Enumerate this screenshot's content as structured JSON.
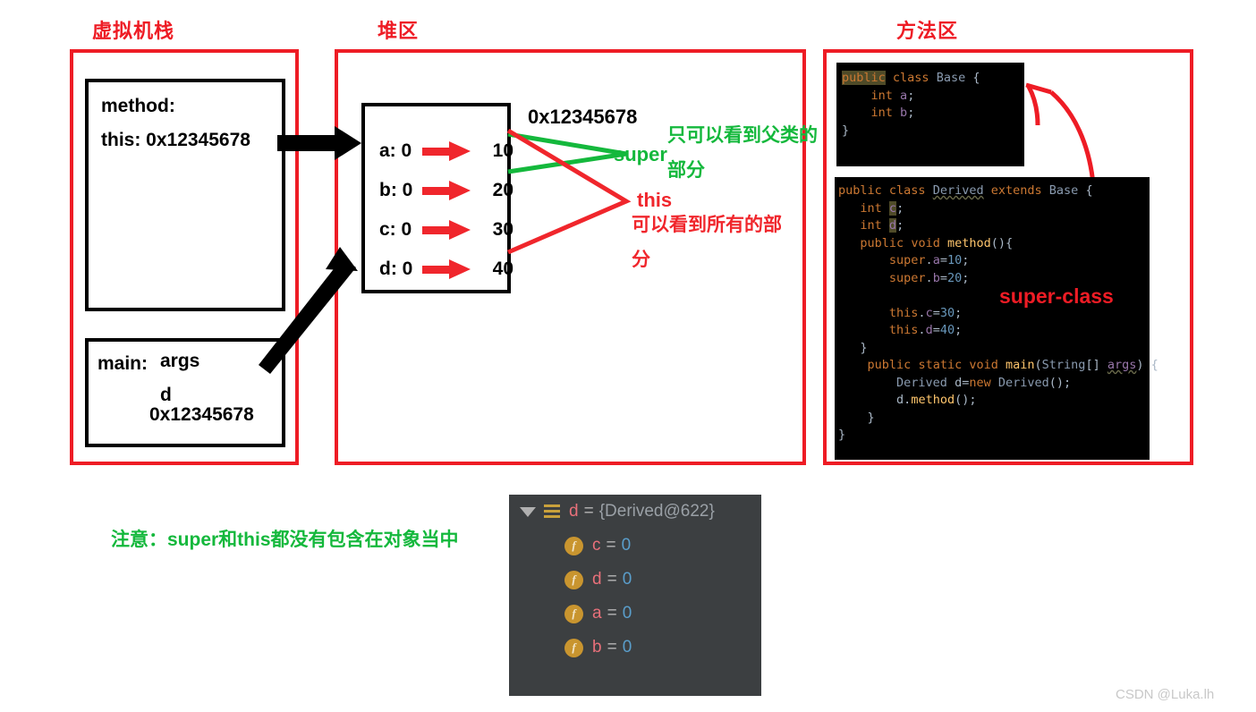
{
  "regions": {
    "stack": {
      "title": "虚拟机栈"
    },
    "heap": {
      "title": "堆区"
    },
    "method_area": {
      "title": "方法区"
    }
  },
  "stack_frames": {
    "method_frame": {
      "line1": "method:",
      "line2": "this: 0x12345678"
    },
    "main_frame": {
      "label": "main:",
      "args": "args",
      "var_name": "d",
      "var_value": "0x12345678"
    }
  },
  "heap": {
    "address": "0x12345678",
    "fields": [
      {
        "name": "a: 0",
        "value": "10"
      },
      {
        "name": "b: 0",
        "value": "20"
      },
      {
        "name": "c: 0",
        "value": "30"
      },
      {
        "name": "d: 0",
        "value": "40"
      }
    ]
  },
  "annotations": {
    "super_label": "super",
    "super_desc_line1": "只可以看到父类的",
    "super_desc_line2": "部分",
    "this_label": "this",
    "this_desc_line1": "可以看到所有的部",
    "this_desc_line2": "分",
    "super_class_label": "super-class",
    "note": "注意：super和this都没有包含在对象当中"
  },
  "code_base": {
    "lines": [
      [
        {
          "t": "public",
          "c": "kw hl"
        },
        {
          "t": " ",
          "c": "pnc"
        },
        {
          "t": "class",
          "c": "kw"
        },
        {
          "t": " ",
          "c": "pnc"
        },
        {
          "t": "Base",
          "c": "typ"
        },
        {
          "t": " {",
          "c": "pnc"
        }
      ],
      [
        {
          "t": "    ",
          "c": "pnc"
        },
        {
          "t": "int",
          "c": "kw"
        },
        {
          "t": " ",
          "c": "pnc"
        },
        {
          "t": "a",
          "c": "fld"
        },
        {
          "t": ";",
          "c": "pnc"
        }
      ],
      [
        {
          "t": "    ",
          "c": "pnc"
        },
        {
          "t": "int",
          "c": "kw"
        },
        {
          "t": " ",
          "c": "pnc"
        },
        {
          "t": "b",
          "c": "fld"
        },
        {
          "t": ";",
          "c": "pnc"
        }
      ],
      [
        {
          "t": "}",
          "c": "pnc"
        }
      ]
    ]
  },
  "code_derived": {
    "lines": [
      [
        {
          "t": "public",
          "c": "kw"
        },
        {
          "t": " ",
          "c": "pnc"
        },
        {
          "t": "class",
          "c": "kw"
        },
        {
          "t": " ",
          "c": "pnc"
        },
        {
          "t": "Derived",
          "c": "typ und"
        },
        {
          "t": " ",
          "c": "pnc"
        },
        {
          "t": "extends",
          "c": "kw"
        },
        {
          "t": " ",
          "c": "pnc"
        },
        {
          "t": "Base",
          "c": "typ"
        },
        {
          "t": " {",
          "c": "pnc"
        }
      ],
      [
        {
          "t": "   ",
          "c": "pnc"
        },
        {
          "t": "int",
          "c": "kw"
        },
        {
          "t": " ",
          "c": "pnc"
        },
        {
          "t": "c",
          "c": "fld hl"
        },
        {
          "t": ";",
          "c": "pnc"
        }
      ],
      [
        {
          "t": "   ",
          "c": "pnc"
        },
        {
          "t": "int",
          "c": "kw"
        },
        {
          "t": " ",
          "c": "pnc"
        },
        {
          "t": "d",
          "c": "fld hl"
        },
        {
          "t": ";",
          "c": "pnc"
        }
      ],
      [
        {
          "t": "   ",
          "c": "pnc"
        },
        {
          "t": "public",
          "c": "kw"
        },
        {
          "t": " ",
          "c": "pnc"
        },
        {
          "t": "void",
          "c": "kw"
        },
        {
          "t": " ",
          "c": "pnc"
        },
        {
          "t": "method",
          "c": "mth"
        },
        {
          "t": "(){",
          "c": "pnc"
        }
      ],
      [
        {
          "t": "       ",
          "c": "pnc"
        },
        {
          "t": "super",
          "c": "kw"
        },
        {
          "t": ".",
          "c": "pnc"
        },
        {
          "t": "a",
          "c": "fld"
        },
        {
          "t": "=",
          "c": "pnc"
        },
        {
          "t": "10",
          "c": "num"
        },
        {
          "t": ";",
          "c": "pnc"
        }
      ],
      [
        {
          "t": "       ",
          "c": "pnc"
        },
        {
          "t": "super",
          "c": "kw"
        },
        {
          "t": ".",
          "c": "pnc"
        },
        {
          "t": "b",
          "c": "fld"
        },
        {
          "t": "=",
          "c": "pnc"
        },
        {
          "t": "20",
          "c": "num"
        },
        {
          "t": ";",
          "c": "pnc"
        }
      ],
      [
        {
          "t": "",
          "c": "pnc"
        }
      ],
      [
        {
          "t": "       ",
          "c": "pnc"
        },
        {
          "t": "this",
          "c": "kw"
        },
        {
          "t": ".",
          "c": "pnc"
        },
        {
          "t": "c",
          "c": "fld"
        },
        {
          "t": "=",
          "c": "pnc"
        },
        {
          "t": "30",
          "c": "num"
        },
        {
          "t": ";",
          "c": "pnc"
        }
      ],
      [
        {
          "t": "       ",
          "c": "pnc"
        },
        {
          "t": "this",
          "c": "kw"
        },
        {
          "t": ".",
          "c": "pnc"
        },
        {
          "t": "d",
          "c": "fld"
        },
        {
          "t": "=",
          "c": "pnc"
        },
        {
          "t": "40",
          "c": "num"
        },
        {
          "t": ";",
          "c": "pnc"
        }
      ],
      [
        {
          "t": "   }",
          "c": "pnc"
        }
      ],
      [
        {
          "t": "    ",
          "c": "pnc"
        },
        {
          "t": "public",
          "c": "kw"
        },
        {
          "t": " ",
          "c": "pnc"
        },
        {
          "t": "static",
          "c": "kw"
        },
        {
          "t": " ",
          "c": "pnc"
        },
        {
          "t": "void",
          "c": "kw"
        },
        {
          "t": " ",
          "c": "pnc"
        },
        {
          "t": "main",
          "c": "mth"
        },
        {
          "t": "(",
          "c": "pnc"
        },
        {
          "t": "String",
          "c": "typ"
        },
        {
          "t": "[] ",
          "c": "pnc"
        },
        {
          "t": "args",
          "c": "fld und"
        },
        {
          "t": ") {",
          "c": "pnc"
        }
      ],
      [
        {
          "t": "        ",
          "c": "pnc"
        },
        {
          "t": "Derived",
          "c": "typ"
        },
        {
          "t": " d=",
          "c": "pnc"
        },
        {
          "t": "new",
          "c": "kw"
        },
        {
          "t": " ",
          "c": "pnc"
        },
        {
          "t": "Derived",
          "c": "typ"
        },
        {
          "t": "();",
          "c": "pnc"
        }
      ],
      [
        {
          "t": "        ",
          "c": "pnc"
        },
        {
          "t": "d",
          "c": "pnc"
        },
        {
          "t": ".",
          "c": "pnc"
        },
        {
          "t": "method",
          "c": "mth"
        },
        {
          "t": "();",
          "c": "pnc"
        }
      ],
      [
        {
          "t": "    }",
          "c": "pnc"
        }
      ],
      [
        {
          "t": "}",
          "c": "pnc"
        }
      ]
    ]
  },
  "debugger": {
    "root": {
      "name": "d",
      "eq": "=",
      "value": "{Derived@622}"
    },
    "children": [
      {
        "icon": "f",
        "name": "c",
        "eq": "=",
        "value": "0"
      },
      {
        "icon": "f",
        "name": "d",
        "eq": "=",
        "value": "0"
      },
      {
        "icon": "f",
        "name": "a",
        "eq": "=",
        "value": "0"
      },
      {
        "icon": "f",
        "name": "b",
        "eq": "=",
        "value": "0"
      }
    ]
  },
  "watermark": "CSDN @Luka.lh",
  "colors": {
    "red": "#ee1c25",
    "arrow_red": "#f0262c",
    "green": "#14b83c",
    "black": "#000000",
    "panel_bg": "#3c3f41",
    "code_bg": "#000000"
  }
}
